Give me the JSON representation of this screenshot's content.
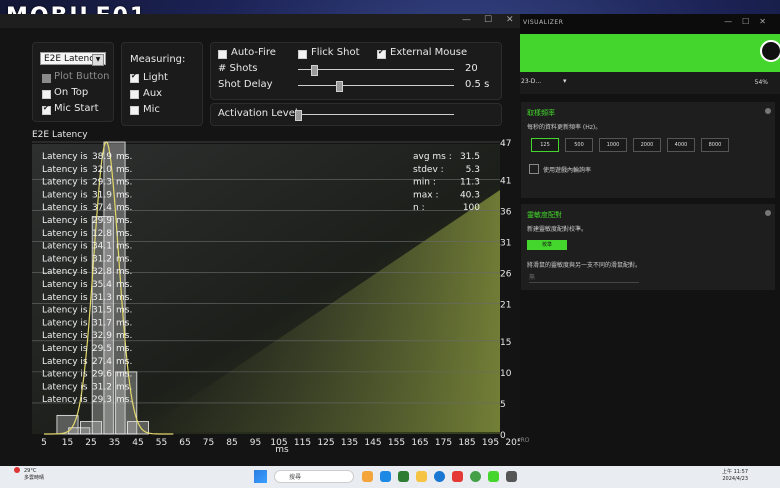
{
  "watermark": "MOBILE01",
  "window_controls": {
    "min": "—",
    "max": "☐",
    "close": "✕"
  },
  "razer": {
    "title": "VISUALIZER",
    "device_select": "23-D...",
    "battery": "54%",
    "polling": {
      "title": "取樣頻率",
      "desc": "每秒的資料更新頻率 (Hz)。",
      "rates": [
        "125",
        "500",
        "1000",
        "2000",
        "4000",
        "8000"
      ],
      "selected": "125",
      "dynamic_label": "使用遊戲內輪詢率"
    },
    "calibration": {
      "title": "靈敏度配對",
      "desc": "新建靈敏度配對校準。",
      "button": "校準",
      "desc2": "將滑鼠的靈敏度與另一支不同的滑鼠配對。",
      "select_placeholder": "無"
    },
    "footer": "PRO"
  },
  "viz": {
    "mode_select": "E2E  Latency",
    "checkboxes": {
      "plot_button": "Plot  Button",
      "on_top": "On  Top",
      "mic_start": "Mic  Start"
    },
    "measuring": {
      "title": "Measuring:",
      "light": "Light",
      "aux": "Aux",
      "mic": "Mic"
    },
    "options": {
      "auto_fire": "Auto-Fire",
      "flick_shot": "Flick  Shot",
      "external_mouse": "External  Mouse",
      "shots_label": "#  Shots",
      "shots_value": "20",
      "shot_delay_label": "Shot  Delay",
      "shot_delay_value": "0.5  s",
      "activation_label": "Activation  Level"
    },
    "chart_title": "E2E  Latency"
  },
  "chart_data": {
    "type": "bar",
    "title": "E2E  Latency",
    "xlabel": "ms",
    "ylabel": "",
    "x_ticks": [
      5,
      15,
      25,
      35,
      45,
      55,
      65,
      75,
      85,
      95,
      105,
      115,
      125,
      135,
      145,
      155,
      165,
      175,
      185,
      195,
      205
    ],
    "y_ticks": [
      0,
      5,
      10,
      15,
      21,
      26,
      31,
      36,
      41,
      47
    ],
    "xlim": [
      0,
      205
    ],
    "ylim": [
      0,
      47
    ],
    "bins": [
      {
        "x": 15,
        "count": 3
      },
      {
        "x": 20,
        "count": 1
      },
      {
        "x": 25,
        "count": 2
      },
      {
        "x": 30,
        "count": 35
      },
      {
        "x": 35,
        "count": 47
      },
      {
        "x": 40,
        "count": 10
      },
      {
        "x": 45,
        "count": 2
      }
    ],
    "latencies": [
      "38.9",
      "32.0",
      "29.3",
      "31.9",
      "37.4",
      "29.9",
      "12.8",
      "34.1",
      "31.2",
      "32.8",
      "35.4",
      "31.3",
      "31.5",
      "31.7",
      "32.9",
      "29.5",
      "27.4",
      "29.6",
      "31.2",
      "29.3"
    ],
    "latency_prefix": "Latency  is",
    "latency_unit": "ms.",
    "stats": [
      {
        "label": "avg  ms  :",
        "value": "31.5"
      },
      {
        "label": "stdev  :",
        "value": "5.3"
      },
      {
        "label": "min  :",
        "value": "11.3"
      },
      {
        "label": "max  :",
        "value": "40.3"
      },
      {
        "label": "n  :",
        "value": "100"
      }
    ]
  },
  "taskbar": {
    "weather_temp": "29°C",
    "weather_desc": "多雲時晴",
    "search": "搜尋",
    "time": "上午 11:57",
    "date": "2024/4/23"
  }
}
